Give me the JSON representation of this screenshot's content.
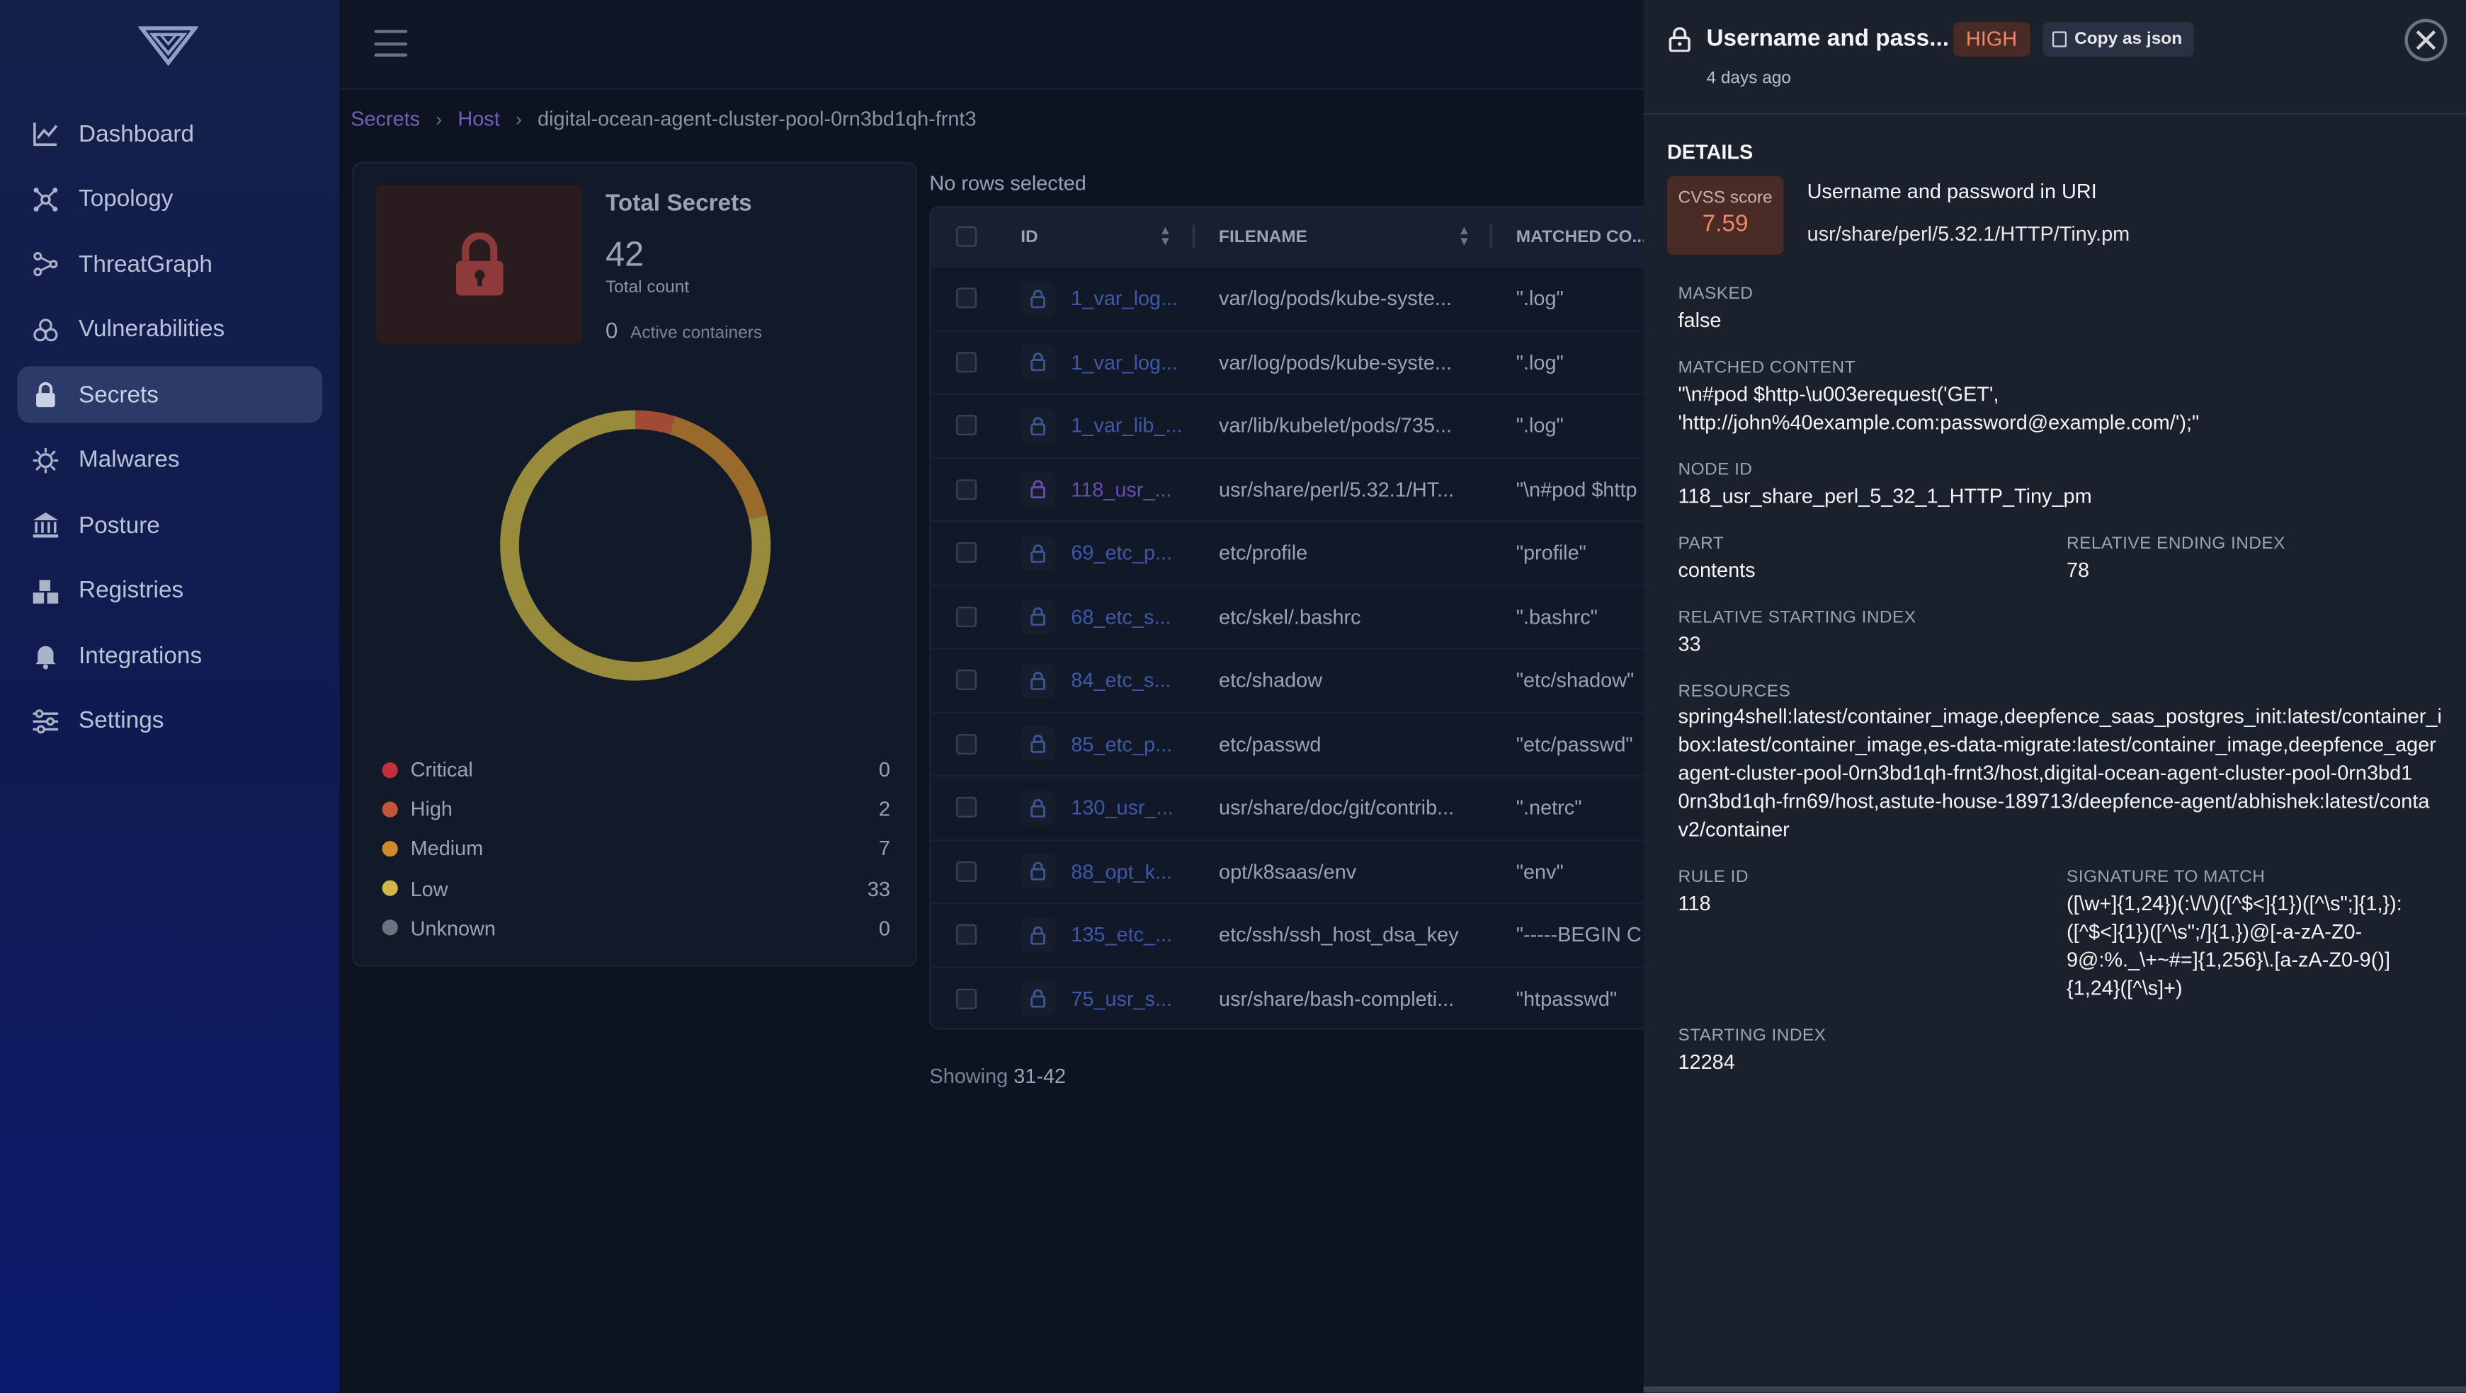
{
  "sidebar": {
    "items": [
      {
        "label": "Dashboard",
        "icon": "dashboard-chart-icon"
      },
      {
        "label": "Topology",
        "icon": "topology-icon"
      },
      {
        "label": "ThreatGraph",
        "icon": "threatgraph-icon"
      },
      {
        "label": "Vulnerabilities",
        "icon": "biohazard-icon"
      },
      {
        "label": "Secrets",
        "icon": "lock-icon",
        "active": true
      },
      {
        "label": "Malwares",
        "icon": "bug-icon"
      },
      {
        "label": "Posture",
        "icon": "bank-icon"
      },
      {
        "label": "Registries",
        "icon": "registry-icon"
      },
      {
        "label": "Integrations",
        "icon": "bell-icon"
      },
      {
        "label": "Settings",
        "icon": "sliders-icon"
      }
    ]
  },
  "breadcrumb": {
    "secrets": "Secrets",
    "host": "Host",
    "current": "digital-ocean-agent-cluster-pool-0rn3bd1qh-frnt3"
  },
  "summary": {
    "title": "Total Secrets",
    "count": "42",
    "count_label": "Total count",
    "active_count": "0",
    "active_label": "Active containers",
    "legend": [
      {
        "name": "Critical",
        "value": 0,
        "color": "#c2303a"
      },
      {
        "name": "High",
        "value": 2,
        "color": "#c2553a"
      },
      {
        "name": "Medium",
        "value": 7,
        "color": "#d08a2a"
      },
      {
        "name": "Low",
        "value": 33,
        "color": "#d4b548"
      },
      {
        "name": "Unknown",
        "value": 0,
        "color": "#6b7280"
      }
    ]
  },
  "table": {
    "no_rows": "No rows selected",
    "headers": {
      "id": "ID",
      "filename": "FILENAME",
      "matched": "MATCHED CO..."
    },
    "rows": [
      {
        "id": "1_var_log...",
        "filename": "var/log/pods/kube-syste...",
        "matched": "\".log\""
      },
      {
        "id": "1_var_log...",
        "filename": "var/log/pods/kube-syste...",
        "matched": "\".log\""
      },
      {
        "id": "1_var_lib_...",
        "filename": "var/lib/kubelet/pods/735...",
        "matched": "\".log\""
      },
      {
        "id": "118_usr_...",
        "filename": "usr/share/perl/5.32.1/HT...",
        "matched": "\"\\n#pod $http"
      },
      {
        "id": "69_etc_p...",
        "filename": "etc/profile",
        "matched": "\"profile\""
      },
      {
        "id": "68_etc_s...",
        "filename": "etc/skel/.bashrc",
        "matched": "\".bashrc\""
      },
      {
        "id": "84_etc_s...",
        "filename": "etc/shadow",
        "matched": "\"etc/shadow\""
      },
      {
        "id": "85_etc_p...",
        "filename": "etc/passwd",
        "matched": "\"etc/passwd\""
      },
      {
        "id": "130_usr_...",
        "filename": "usr/share/doc/git/contrib...",
        "matched": "\".netrc\""
      },
      {
        "id": "88_opt_k...",
        "filename": "opt/k8saas/env",
        "matched": "\"env\""
      },
      {
        "id": "135_etc_...",
        "filename": "etc/ssh/ssh_host_dsa_key",
        "matched": "\"-----BEGIN C"
      },
      {
        "id": "75_usr_s...",
        "filename": "usr/share/bash-completi...",
        "matched": "\"htpasswd\""
      }
    ],
    "showing_prefix": "Showing",
    "showing_range": "31-42"
  },
  "drawer": {
    "title": "Username and pass...",
    "severity": "HIGH",
    "copy_label": "Copy as json",
    "time": "4 days ago",
    "details_heading": "DETAILS",
    "cvss_label": "CVSS score",
    "cvss_value": "7.59",
    "rule_name": "Username and password in URI",
    "file": "usr/share/perl/5.32.1/HTTP/Tiny.pm",
    "masked_label": "MASKED",
    "masked_value": "false",
    "matched_label": "MATCHED CONTENT",
    "matched_line1": "\"\\n#pod $http-\\u003erequest('GET',",
    "matched_line2": "'http://john%40example.com:password@example.com/');\"",
    "node_label": "NODE ID",
    "node_value": "118_usr_share_perl_5_32_1_HTTP_Tiny_pm",
    "part_label": "PART",
    "part_value": "contents",
    "rel_end_label": "RELATIVE ENDING INDEX",
    "rel_end_value": "78",
    "rel_start_label": "RELATIVE STARTING INDEX",
    "rel_start_value": "33",
    "resources_label": "RESOURCES",
    "resources_lines": [
      "spring4shell:latest/container_image,deepfence_saas_postgres_init:latest/container_i",
      "box:latest/container_image,es-data-migrate:latest/container_image,deepfence_ager",
      "agent-cluster-pool-0rn3bd1qh-frnt3/host,digital-ocean-agent-cluster-pool-0rn3bd1",
      "0rn3bd1qh-frn69/host,astute-house-189713/deepfence-agent/abhishek:latest/conta",
      "v2/container"
    ],
    "rule_id_label": "RULE ID",
    "rule_id_value": "118",
    "sig_label": "SIGNATURE TO MATCH",
    "sig_lines": [
      "([\\w+]{1,24})(:\\/\\/)([^$<]{1})([^\\s\";]{1,}):",
      "([^$<]{1})([^\\s\";/]{1,})@[-a-zA-Z0-",
      "9@:%._\\+~#=]{1,256}\\.[a-zA-Z0-9()]",
      "{1,24}([^\\s]+)"
    ],
    "start_label": "STARTING INDEX",
    "start_value": "12284"
  }
}
